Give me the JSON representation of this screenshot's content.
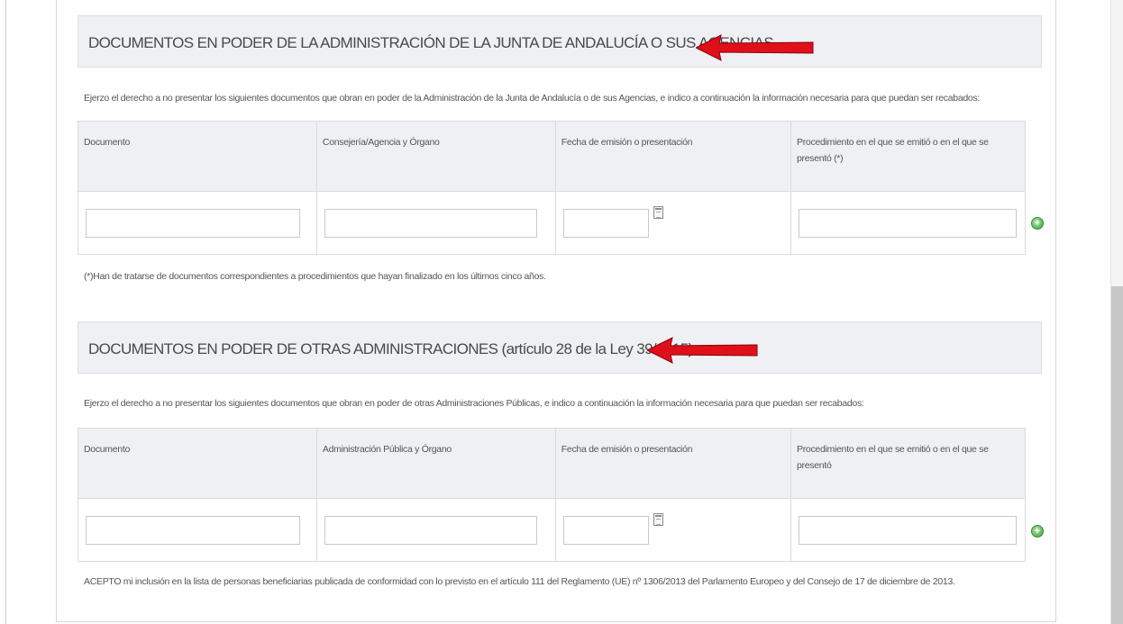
{
  "section_1": {
    "title": "DOCUMENTOS EN PODER DE LA ADMINISTRACIÓN DE LA JUNTA DE ANDALUCÍA O SUS AGENCIAS",
    "intro": "Ejerzo el derecho a no presentar los siguientes documentos que obran en poder de la Administración de la Junta de Andalucía o de sus Agencias, e indico a continuación la información necesaria para que puedan ser recabados:",
    "columns": [
      "Documento",
      "Consejería/Agencia y Órgano",
      "Fecha de emisión o presentación",
      "Procedimiento en el que se emitió o en el que se presentó (*)"
    ],
    "row": {
      "documento": "",
      "organo": "",
      "fecha": "",
      "procedimiento": ""
    },
    "note": "(*)Han de tratarse de documentos correspondientes a procedimientos que hayan finalizado en los últimos cinco años."
  },
  "section_2": {
    "title": "DOCUMENTOS EN PODER DE OTRAS ADMINISTRACIONES (artículo 28 de la Ley 39/2015)",
    "intro": "Ejerzo el derecho a no presentar los siguientes documentos que obran en poder de otras Administraciones Públicas, e indico a continuación la información necesaria para que puedan ser recabados:",
    "columns": [
      "Documento",
      "Administración Pública y Órgano",
      "Fecha de emisión o presentación",
      "Procedimiento en el que se emitió o en el que se presentó"
    ],
    "row": {
      "documento": "",
      "organo": "",
      "fecha": "",
      "procedimiento": ""
    },
    "note": "ACEPTO mi inclusión en la lista de personas beneficiarias publicada de conformidad con lo previsto en el artículo 111 del Reglamento (UE) nº 1306/2013 del Parlamento Europeo y del Consejo de 17 de diciembre de 2013."
  },
  "icons": {
    "calendar": "calendar-icon",
    "add": "add-row-icon",
    "arrow": "arrow-left-icon"
  },
  "colors": {
    "arrow": "#e0101a",
    "header_bg": "#eef0f4",
    "add_button": "#3fa23a"
  }
}
